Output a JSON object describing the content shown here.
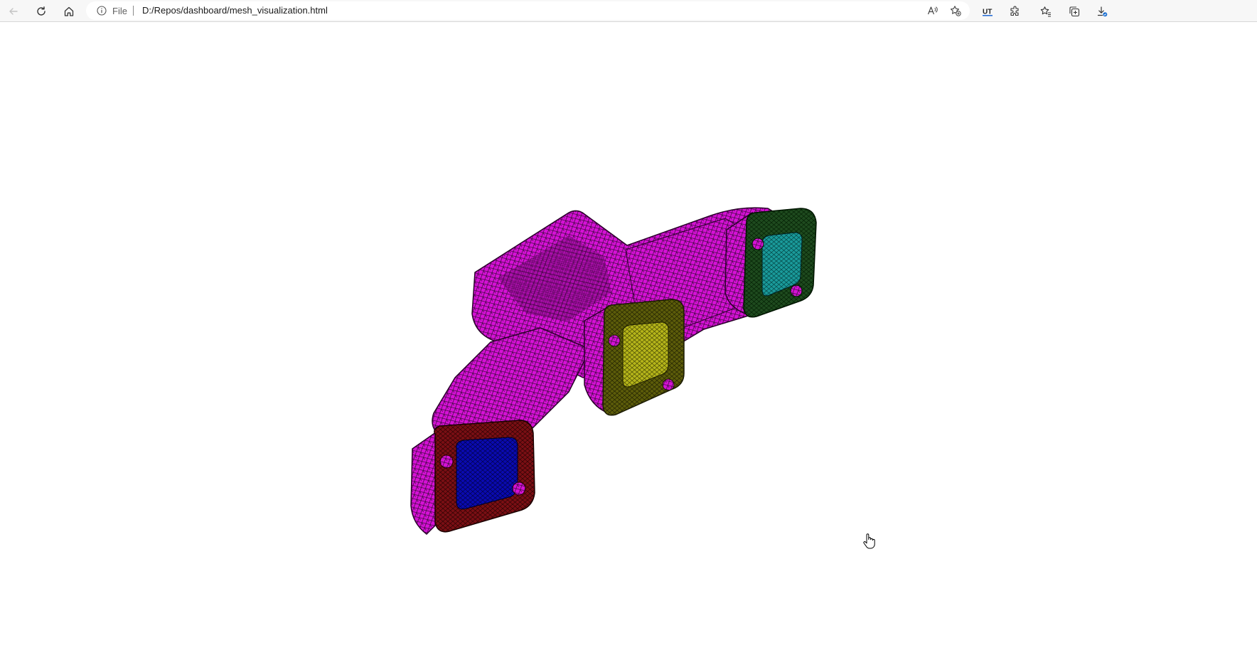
{
  "browser": {
    "address_bar": {
      "site_label": "File",
      "url": "D:/Repos/dashboard/mesh_visualization.html"
    },
    "toolbar_icons": [
      "back-icon",
      "refresh-icon",
      "home-icon",
      "read-aloud-icon",
      "add-favorite-icon",
      "extension-ut-icon",
      "extensions-icon",
      "favorites-icon",
      "collections-icon",
      "downloads-icon"
    ],
    "extension_badge": "UT"
  },
  "mesh": {
    "body_color": "#d40fd4",
    "inlet_colors": {
      "red_flange": "#7a0f14",
      "blue_face": "#0a0ab0",
      "olive_flange": "#5c5c0a",
      "yellow_face": "#b5b51a",
      "green_flange": "#1e4a1e",
      "teal_face": "#1a9a9a"
    }
  }
}
